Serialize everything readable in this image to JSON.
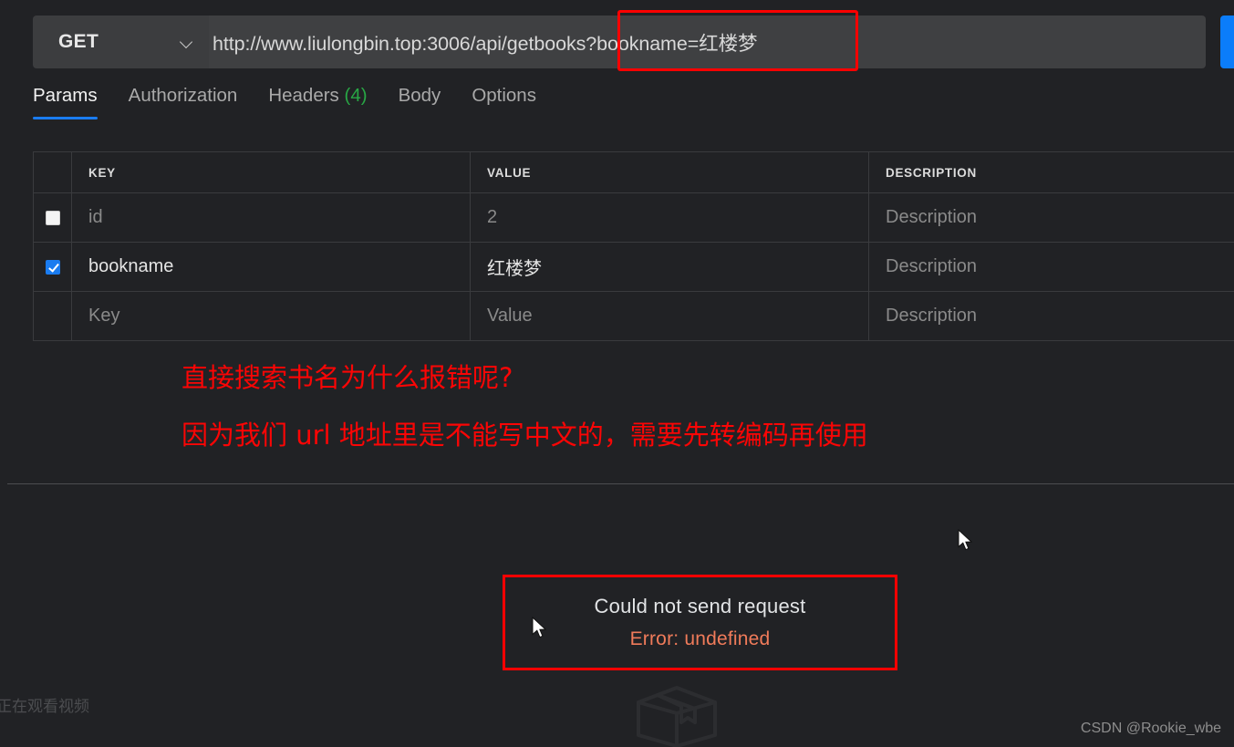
{
  "request": {
    "method": "GET",
    "method_chevron_icon": "chevron-down-icon",
    "url_base": "http://www.liulongbin.top:3006/api/getbooks",
    "url_query": "?bookname=红楼梦",
    "url_full": "http://www.liulongbin.top:3006/api/getbooks?bookname=红楼梦",
    "send_button_label": ""
  },
  "tabs": [
    {
      "label": "Params",
      "count": "",
      "active": true
    },
    {
      "label": "Authorization",
      "count": "",
      "active": false
    },
    {
      "label": "Headers",
      "count": "(4)",
      "active": false
    },
    {
      "label": "Body",
      "count": "",
      "active": false
    },
    {
      "label": "Options",
      "count": "",
      "active": false
    }
  ],
  "params_table": {
    "headers": {
      "key": "KEY",
      "value": "VALUE",
      "description": "DESCRIPTION"
    },
    "rows": [
      {
        "checked": false,
        "key": "id",
        "value": "2",
        "description": "Description",
        "placeholder_row": false,
        "dim": true
      },
      {
        "checked": true,
        "key": "bookname",
        "value": "红楼梦",
        "description": "Description",
        "placeholder_row": false,
        "dim": false
      },
      {
        "checked": null,
        "key": "Key",
        "value": "Value",
        "description": "Description",
        "placeholder_row": true,
        "dim": true
      }
    ]
  },
  "annotation": {
    "line1": "直接搜索书名为什么报错呢?",
    "line2": "因为我们 url 地址里是不能写中文的，需要先转编码再使用",
    "color": "#fb0505"
  },
  "error_panel": {
    "title": "Could not send request",
    "subtitle": "Error: undefined",
    "border_color": "#fe0000",
    "subtitle_color": "#f07b5a"
  },
  "watermarks": {
    "left": "正在观看视频",
    "right": "CSDN @Rookie_wbe",
    "placeholder_icon": "package-box-icon"
  },
  "colors": {
    "background": "#212225",
    "field_background": "#3f4042",
    "method_background": "#3c3d3f",
    "accent_blue": "#1a7cf0",
    "send_blue": "#0b7dfa",
    "header_count_green": "#28a745",
    "border": "#3a3b3e"
  }
}
